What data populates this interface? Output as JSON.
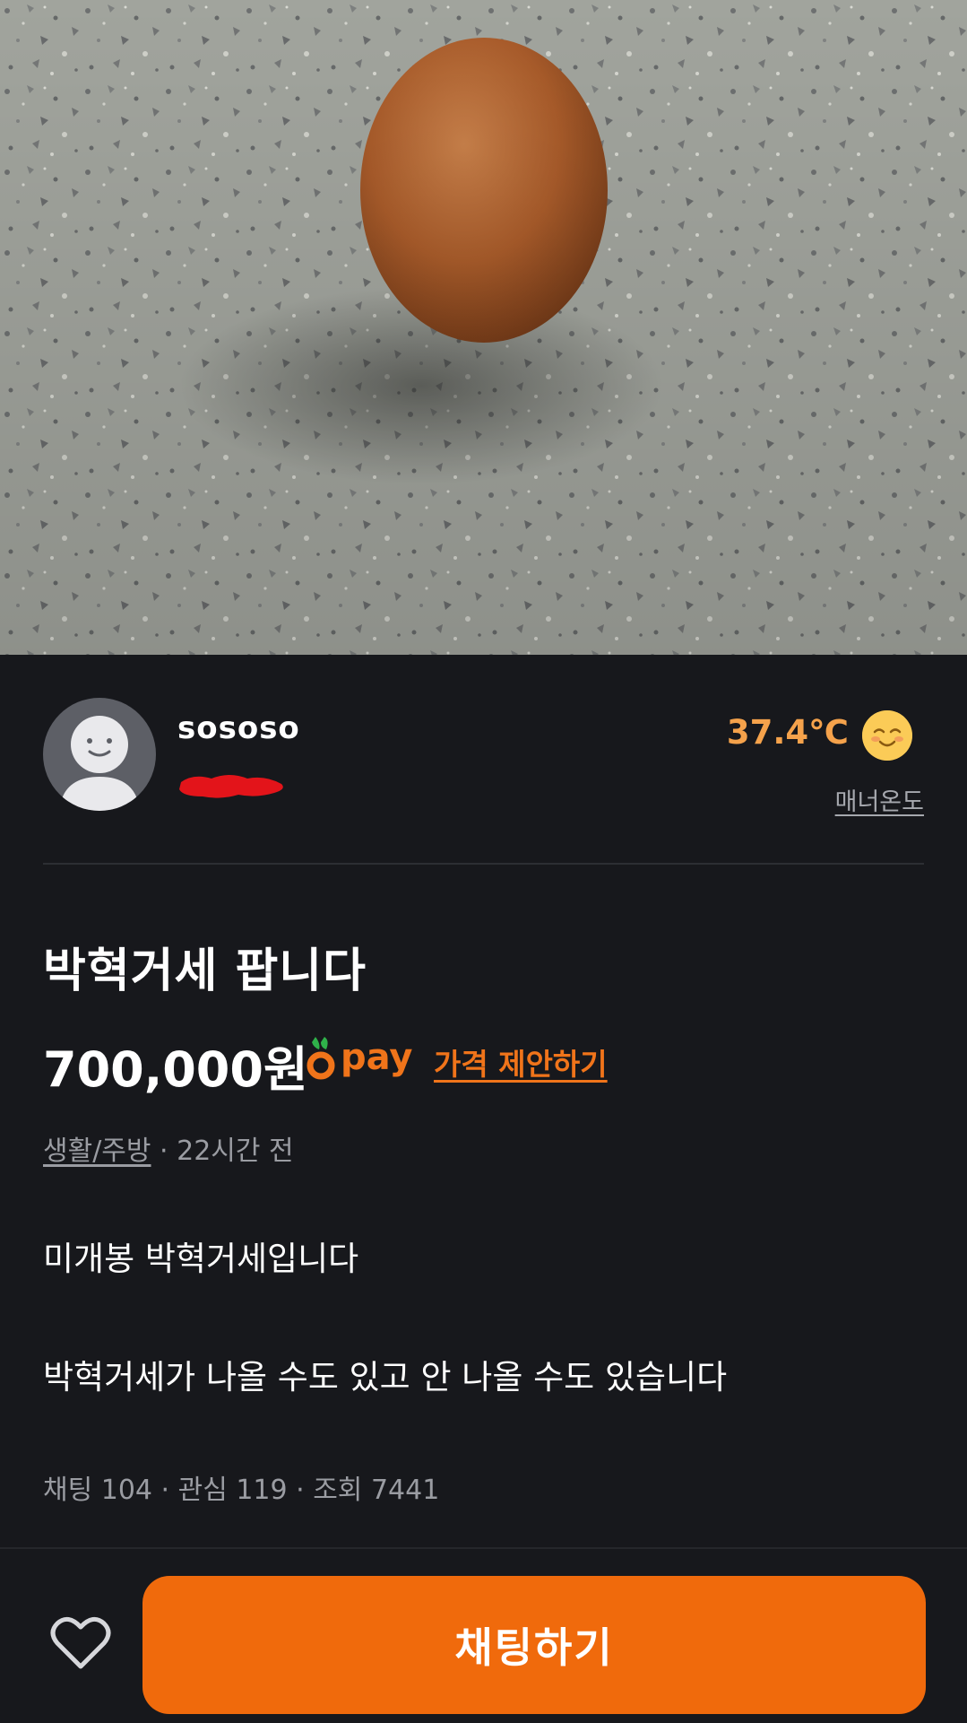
{
  "listing": {
    "image_alt": "egg-on-terrazzo-photo",
    "title": "박혁거세 팝니다",
    "price": "700,000원",
    "pay_badge": "pay",
    "offer_link": "가격 제안하기",
    "category": "생활/주방",
    "time_ago": " · 22시간 전",
    "description_line1": "미개봉 박혁거세입니다",
    "description_line2": "박혁거세가 나올 수도 있고 안 나올 수도 있습니다",
    "stats": "채팅 104 · 관심 119 · 조회 7441"
  },
  "seller": {
    "name": "sososo",
    "manner_temp": "37.4℃",
    "manner_label": "매너온도",
    "avatar_icon": "default-profile-icon",
    "temp_icon": "smiling-face-icon"
  },
  "actions": {
    "like_icon": "heart-outline-icon",
    "chat_button": "채팅하기"
  },
  "colors": {
    "accent": "#f06a0c",
    "temperature": "#f5a24b",
    "background": "#17181c"
  }
}
